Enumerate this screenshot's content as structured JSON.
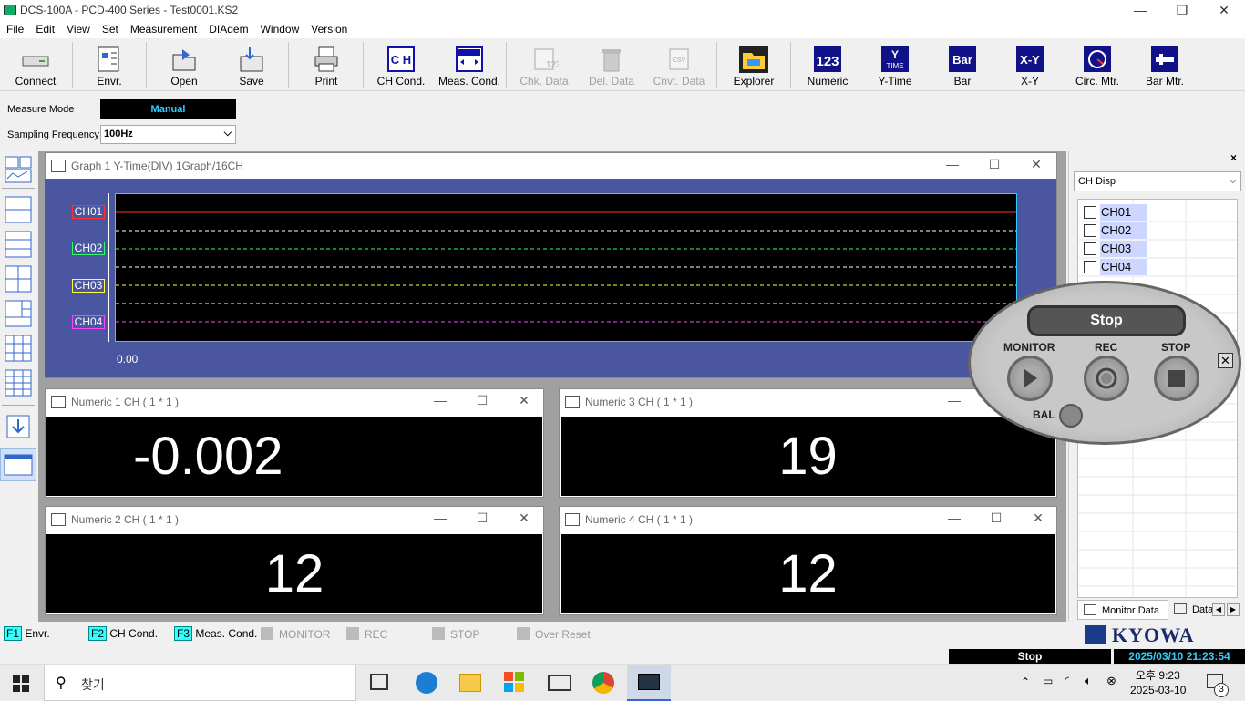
{
  "window": {
    "title": "DCS-100A - PCD-400 Series - Test0001.KS2"
  },
  "menu": [
    "File",
    "Edit",
    "View",
    "Set",
    "Measurement",
    "DIAdem",
    "Window",
    "Version"
  ],
  "toolbar": {
    "connect": "Connect",
    "envr": "Envr.",
    "open": "Open",
    "save": "Save",
    "print": "Print",
    "ch_cond": "CH Cond.",
    "meas_cond": "Meas. Cond.",
    "chk_data": "Chk. Data",
    "del_data": "Del. Data",
    "cnvt_data": "Cnvt. Data",
    "explorer": "Explorer",
    "numeric": "Numeric",
    "y_time": "Y-Time",
    "bar": "Bar",
    "x_y": "X-Y",
    "circ_mtr": "Circ. Mtr.",
    "bar_mtr": "Bar Mtr."
  },
  "controls": {
    "measure_mode_label": "Measure Mode",
    "measure_mode_value": "Manual",
    "sampling_label": "Sampling Frequency",
    "sampling_value": "100Hz"
  },
  "graph": {
    "title": "Graph 1 Y-Time(DIV) 1Graph/16CH",
    "x_start": "0.00",
    "channels": [
      {
        "name": "CH01",
        "color": "#ff3030"
      },
      {
        "name": "CH02",
        "color": "#30ff60"
      },
      {
        "name": "CH03",
        "color": "#ffff40"
      },
      {
        "name": "CH04",
        "color": "#ff40ff"
      }
    ]
  },
  "numerics": [
    {
      "title": "Numeric 1 CH  ( 1 * 1 )",
      "value": "-0.002"
    },
    {
      "title": "Numeric 3 CH  ( 1 * 1 )",
      "value": "19"
    },
    {
      "title": "Numeric 2 CH  ( 1 * 1 )",
      "value": "12"
    },
    {
      "title": "Numeric 4 CH  ( 1 * 1 )",
      "value": "12"
    }
  ],
  "right_panel": {
    "dropdown": "CH Disp",
    "channels": [
      "CH01",
      "CH02",
      "CH03",
      "CH04"
    ],
    "tab1": "Monitor Data",
    "tab2": "Data"
  },
  "control_panel": {
    "status": "Stop",
    "monitor": "MONITOR",
    "rec": "REC",
    "stop": "STOP",
    "bal": "BAL"
  },
  "statusbar": {
    "f1": "F1",
    "f1_label": "Envr.",
    "f2": "F2",
    "f2_label": "CH Cond.",
    "f3": "F3",
    "f3_label": "Meas. Cond.",
    "monitor": "MONITOR",
    "rec": "REC",
    "stop": "STOP",
    "over_reset": "Over Reset",
    "brand": "KYOWA"
  },
  "bottom": {
    "state": "Stop",
    "datetime": "2025/03/10 21:23:54"
  },
  "taskbar": {
    "search": "찾기",
    "time": "오후 9:23",
    "date": "2025-03-10",
    "notif": "3"
  }
}
